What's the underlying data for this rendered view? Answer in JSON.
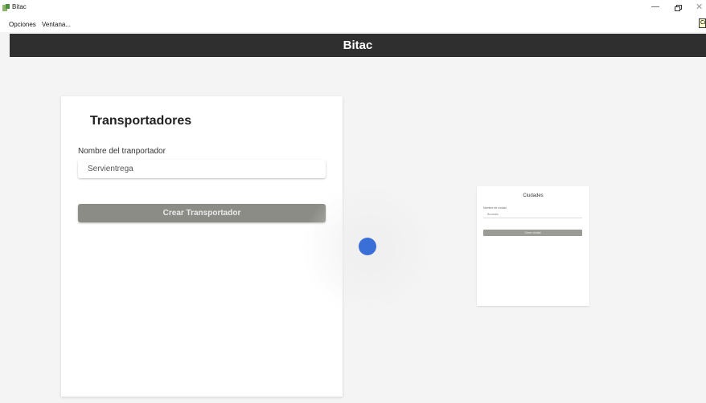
{
  "window": {
    "title": "Bitac",
    "minimize": "—",
    "restore": "",
    "close": "✕",
    "corner_tooltip": "Ci"
  },
  "menu": {
    "items": [
      "Opciones",
      "Ventana..."
    ]
  },
  "header": {
    "title": "Bitac"
  },
  "form": {
    "title": "Transportadores",
    "label": "Nombre del tranportador",
    "value": "Servientrega",
    "button": "Crear Transportador"
  },
  "spinner": {
    "color": "#3a6fd8"
  },
  "ciudades_preview": {
    "title": "Ciudades",
    "label": "Nombre de ciudad",
    "value": "Bucaralo",
    "button": "Crear ciudad"
  },
  "colors": {
    "header_bg": "#2f2f2f",
    "button_bg": "#8c8c86"
  }
}
